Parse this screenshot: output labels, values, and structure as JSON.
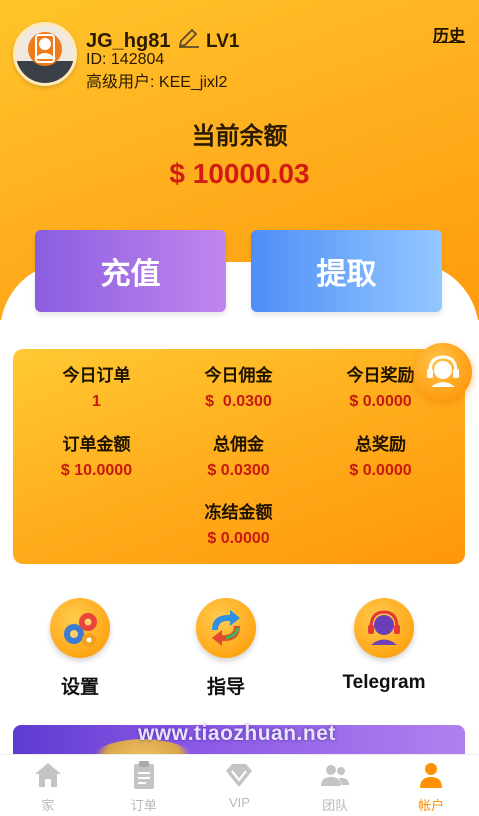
{
  "user": {
    "username": "JG_hg81",
    "level": "LV1",
    "id_text": "ID: 142804",
    "superior_text": "高级用户: KEE_jixl2"
  },
  "header": {
    "history_label": "历史"
  },
  "balance": {
    "title": "当前余额",
    "amount": "$  10000.03"
  },
  "actions": {
    "recharge_label": "充值",
    "withdraw_label": "提取"
  },
  "stats": [
    {
      "label": "今日订单",
      "value": "1"
    },
    {
      "label": "今日佣金",
      "value": "$  0.0300"
    },
    {
      "label": "今日奖励",
      "value": "$ 0.0000"
    },
    {
      "label": "订单金额",
      "value": "$ 10.0000"
    },
    {
      "label": "总佣金",
      "value": "$ 0.0300"
    },
    {
      "label": "总奖励",
      "value": "$ 0.0000"
    },
    {
      "label": "冻结金额",
      "value": "$ 0.0000"
    }
  ],
  "quick_links": [
    {
      "label": "设置",
      "icon": "gears-icon"
    },
    {
      "label": "指导",
      "icon": "refresh-arrows-icon"
    },
    {
      "label": "Telegram",
      "icon": "headset-agent-icon"
    }
  ],
  "watermark": "www.tiaozhuan.net",
  "tabbar": [
    {
      "label": "家",
      "icon": "home-icon",
      "active": false
    },
    {
      "label": "订单",
      "icon": "clipboard-icon",
      "active": false
    },
    {
      "label": "VIP",
      "icon": "diamond-icon",
      "active": false
    },
    {
      "label": "团队",
      "icon": "team-icon",
      "active": false
    },
    {
      "label": "帐户",
      "icon": "account-icon",
      "active": true
    }
  ],
  "colors": {
    "header_gradient": [
      "#ffc42a",
      "#ff9a0c"
    ],
    "amount_red": "#d21b12",
    "recharge_gradient": [
      "#8a5ee0",
      "#c185ee"
    ],
    "withdraw_gradient": [
      "#4f8ef8",
      "#93c7ff"
    ],
    "tab_active": "#ff8c00",
    "tab_inactive": "#b8b8b8"
  }
}
